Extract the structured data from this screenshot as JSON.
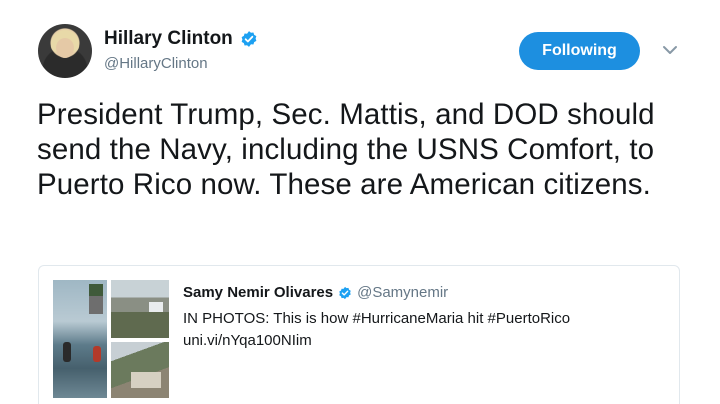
{
  "author": {
    "display_name": "Hillary Clinton",
    "handle": "@HillaryClinton",
    "verified": true
  },
  "actions": {
    "follow_label": "Following",
    "menu_icon": "chevron-down-icon"
  },
  "tweet": {
    "text": "President Trump, Sec. Mattis, and DOD should send the Navy, including the USNS Comfort, to Puerto Rico now. These are American citizens."
  },
  "quoted_tweet": {
    "display_name": "Samy Nemir Olivares",
    "handle": "@Samynemir",
    "verified": true,
    "text": "IN PHOTOS: This is how #HurricaneMaria hit #PuertoRico",
    "link": "uni.vi/nYqa100NIim"
  },
  "colors": {
    "accent": "#1d8fe0",
    "verified": "#1da1f2",
    "secondary_text": "#657786",
    "primary_text": "#14171a",
    "border": "#e1e8ed"
  }
}
